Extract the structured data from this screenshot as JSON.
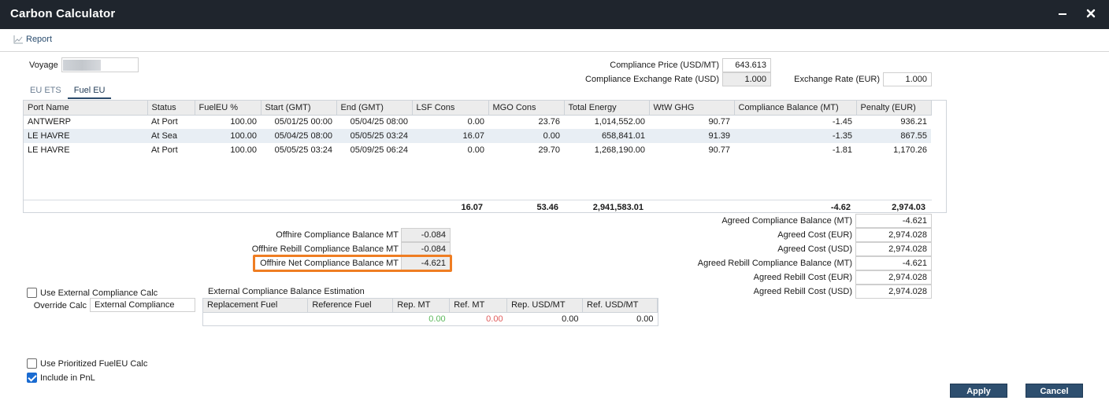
{
  "window": {
    "title": "Carbon Calculator"
  },
  "toolbar": {
    "report_label": "Report"
  },
  "voyage": {
    "label": "Voyage"
  },
  "pricing": {
    "compliance_price_label": "Compliance Price (USD/MT)",
    "compliance_price_value": "643.613",
    "compliance_fx_label": "Compliance Exchange Rate (USD)",
    "compliance_fx_value": "1.000",
    "exchange_rate_label": "Exchange Rate (EUR)",
    "exchange_rate_value": "1.000"
  },
  "tabs": [
    {
      "label": "EU ETS"
    },
    {
      "label": "Fuel EU"
    }
  ],
  "grid": {
    "columns": [
      "Port Name",
      "Status",
      "FuelEU %",
      "Start (GMT)",
      "End (GMT)",
      "LSF Cons",
      "MGO Cons",
      "Total Energy",
      "WtW GHG",
      "Compliance Balance (MT)",
      "Penalty (EUR)"
    ],
    "rows": [
      [
        "ANTWERP",
        "At Port",
        "100.00",
        "05/01/25 00:00",
        "05/04/25 08:00",
        "0.00",
        "23.76",
        "1,014,552.00",
        "90.77",
        "-1.45",
        "936.21"
      ],
      [
        "LE HAVRE",
        "At Sea",
        "100.00",
        "05/04/25 08:00",
        "05/05/25 03:24",
        "16.07",
        "0.00",
        "658,841.01",
        "91.39",
        "-1.35",
        "867.55"
      ],
      [
        "LE HAVRE",
        "At Port",
        "100.00",
        "05/05/25 03:24",
        "05/09/25 06:24",
        "0.00",
        "29.70",
        "1,268,190.00",
        "90.77",
        "-1.81",
        "1,170.26"
      ]
    ],
    "totals": {
      "lsf": "16.07",
      "mgo": "53.46",
      "energy": "2,941,583.01",
      "balance": "-4.62",
      "penalty": "2,974.03"
    }
  },
  "offhire": {
    "balance_label": "Offhire Compliance Balance MT",
    "balance_value": "-0.084",
    "rebill_label": "Offhire Rebill Compliance Balance MT",
    "rebill_value": "-0.084",
    "net_label": "Offhire Net Compliance Balance MT",
    "net_value": "-4.621"
  },
  "agreed": [
    {
      "label": "Agreed Compliance Balance (MT)",
      "value": "-4.621"
    },
    {
      "label": "Agreed Cost (EUR)",
      "value": "2,974.028"
    },
    {
      "label": "Agreed Cost (USD)",
      "value": "2,974.028"
    },
    {
      "label": "Agreed Rebill Compliance Balance (MT)",
      "value": "-4.621"
    },
    {
      "label": "Agreed Rebill Cost (EUR)",
      "value": "2,974.028"
    },
    {
      "label": "Agreed Rebill Cost (USD)",
      "value": "2,974.028"
    }
  ],
  "external": {
    "use_label": "Use External Compliance Calc",
    "use_checked": false,
    "override_label": "Override Calc",
    "override_value": "External Compliance",
    "estimation_title": "External Compliance Balance Estimation",
    "columns": [
      "Replacement Fuel",
      "Reference Fuel",
      "Rep. MT",
      "Ref. MT",
      "Rep. USD/MT",
      "Ref. USD/MT"
    ],
    "row": [
      "",
      "",
      "0.00",
      "0.00",
      "0.00",
      "0.00"
    ],
    "rep_mt_color": "#5cb85c",
    "ref_mt_color": "#e05a5a"
  },
  "options": {
    "prioritized_label": "Use Prioritized FuelEU Calc",
    "prioritized_checked": false,
    "pnl_label": "Include in PnL",
    "pnl_checked": true
  },
  "buttons": {
    "apply": "Apply",
    "cancel": "Cancel"
  },
  "colors": {
    "titlebar": "#1f252d",
    "accent": "#2e4f6f",
    "highlight": "#ef7d22",
    "row_alt": "#e8eef4"
  }
}
